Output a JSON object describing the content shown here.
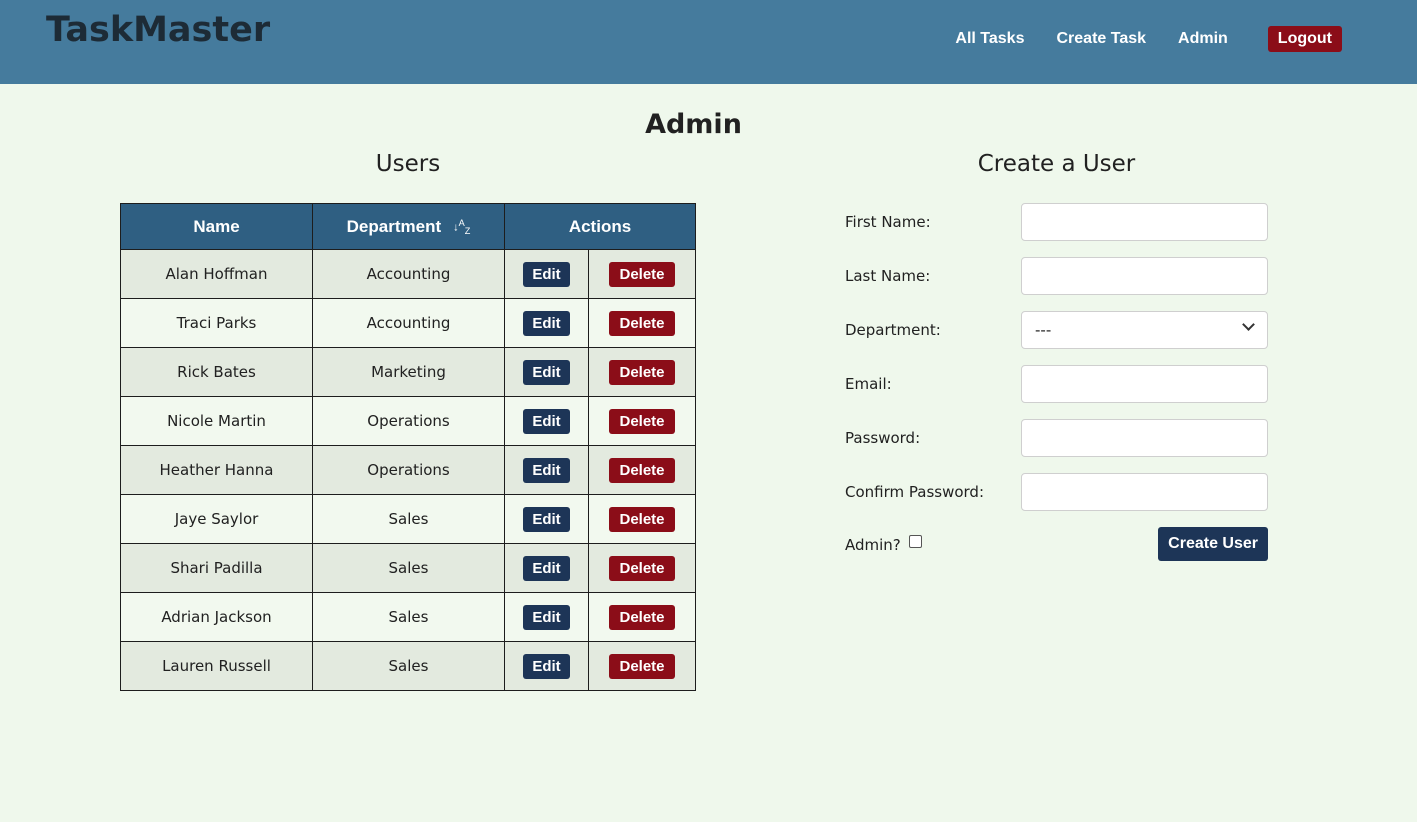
{
  "header": {
    "brand": "TaskMaster",
    "nav": [
      "All Tasks",
      "Create Task",
      "Admin"
    ],
    "logout": "Logout"
  },
  "page_title": "Admin",
  "users": {
    "title": "Users",
    "columns": [
      "Name",
      "Department",
      "Actions"
    ],
    "sort_icon": "sort-alpha-down-icon",
    "edit_label": "Edit",
    "delete_label": "Delete",
    "rows": [
      {
        "name": "Alan Hoffman",
        "department": "Accounting"
      },
      {
        "name": "Traci Parks",
        "department": "Accounting"
      },
      {
        "name": "Rick Bates",
        "department": "Marketing"
      },
      {
        "name": "Nicole Martin",
        "department": "Operations"
      },
      {
        "name": "Heather Hanna",
        "department": "Operations"
      },
      {
        "name": "Jaye Saylor",
        "department": "Sales"
      },
      {
        "name": "Shari Padilla",
        "department": "Sales"
      },
      {
        "name": "Adrian Jackson",
        "department": "Sales"
      },
      {
        "name": "Lauren Russell",
        "department": "Sales"
      }
    ]
  },
  "create_user": {
    "title": "Create a User",
    "first_name_label": "First Name:",
    "last_name_label": "Last Name:",
    "department_label": "Department:",
    "department_value": "---",
    "email_label": "Email:",
    "password_label": "Password:",
    "confirm_password_label": "Confirm Password:",
    "admin_label": "Admin?",
    "submit_label": "Create User"
  },
  "colors": {
    "header_bg": "#457b9d",
    "table_header_bg": "#2f5f82",
    "edit_button": "#1d3557",
    "delete_button": "#8b0d18",
    "page_bg": "#eff8ec"
  }
}
